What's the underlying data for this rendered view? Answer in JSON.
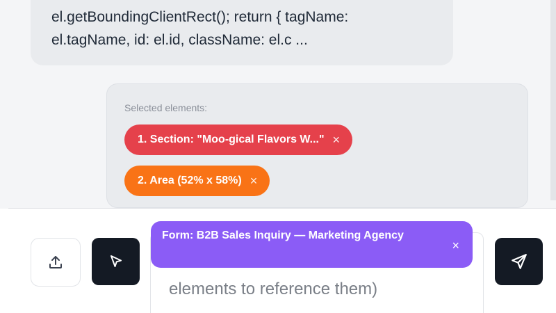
{
  "message": {
    "line1": "el.getBoundingClientRect(); return { tagName:",
    "line2": "el.tagName, id: el.id, className: el.c ..."
  },
  "selected": {
    "title": "Selected elements:",
    "chips": [
      {
        "label": "1. Section: \"Moo-gical Flavors W...\"",
        "close": "×",
        "color": "#e5414b"
      },
      {
        "label": "2. Area (52% x 58%)",
        "close": "×",
        "color": "#f97316"
      }
    ]
  },
  "composer": {
    "upload_icon": "upload-icon",
    "select_icon": "cursor-arrow-icon",
    "send_icon": "send-icon",
    "placeholder_line2": "elements to reference them)",
    "form_chip": {
      "label": "Form: B2B Sales Inquiry — Marketing Agency",
      "close": "×",
      "color": "#8b5cf6"
    }
  }
}
